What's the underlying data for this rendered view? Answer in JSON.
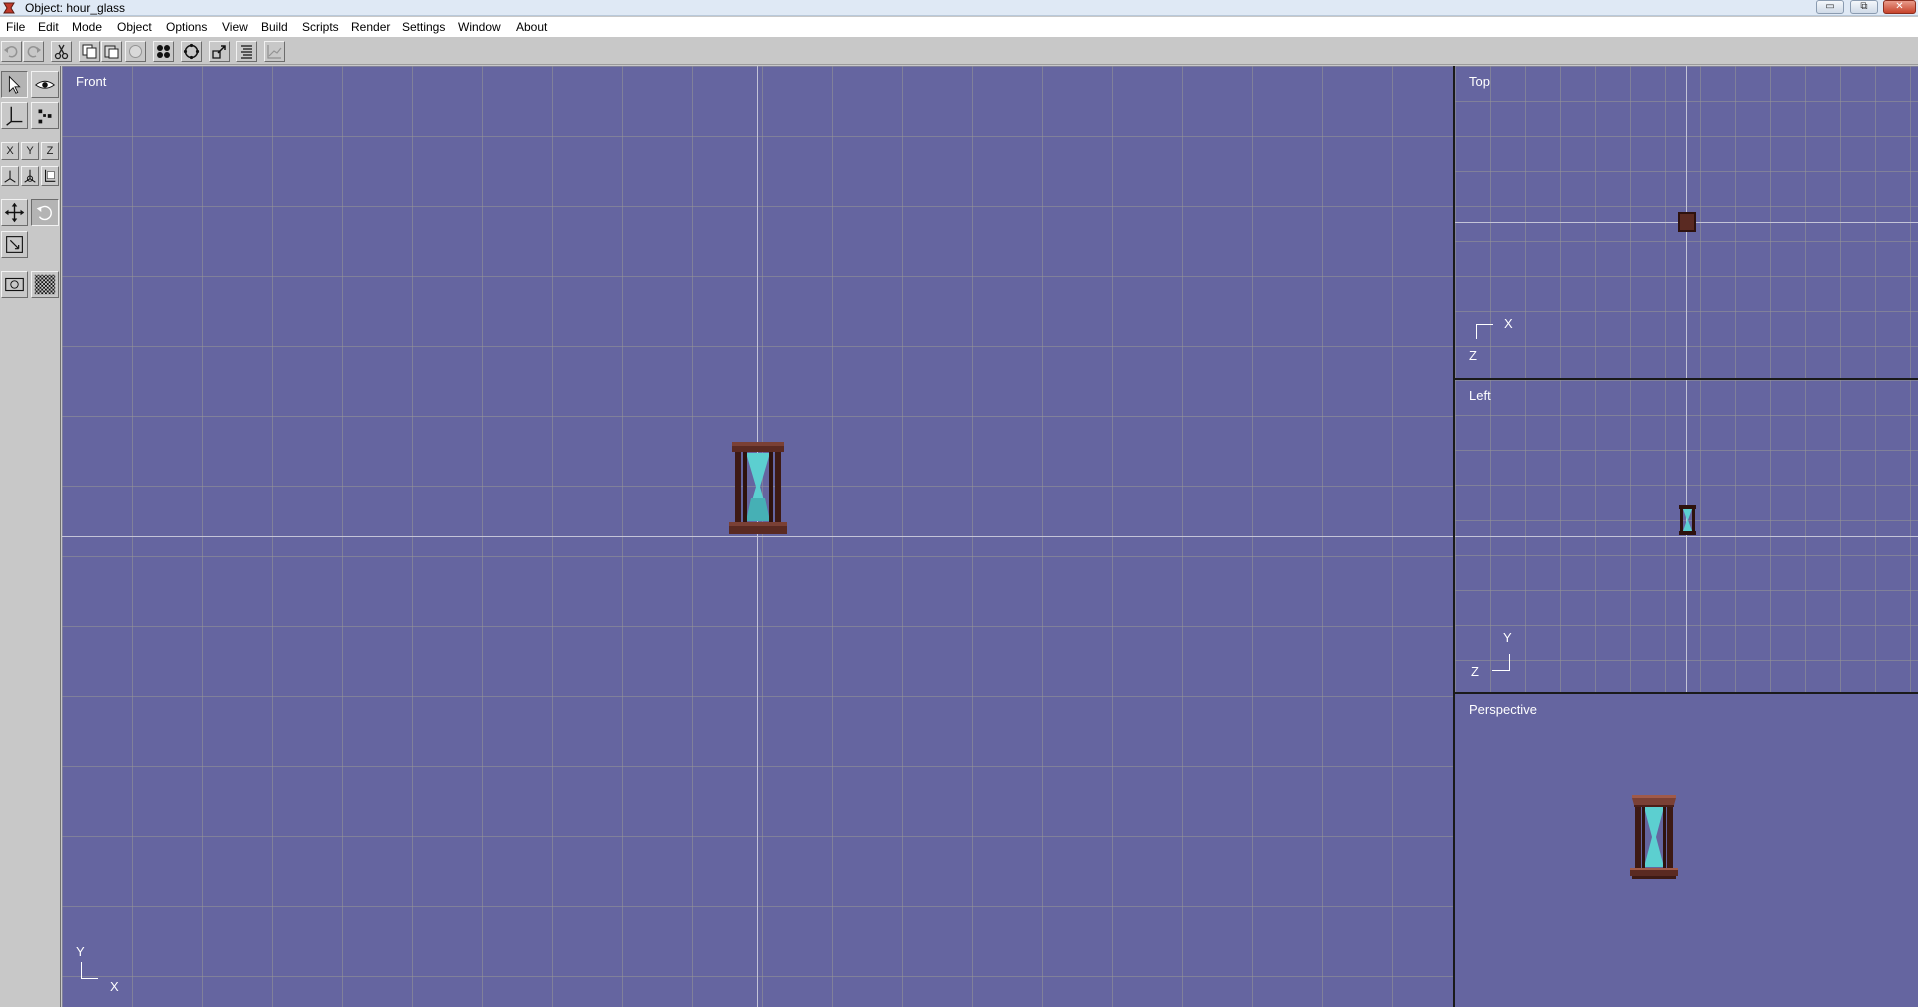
{
  "window": {
    "title": "Object: hour_glass",
    "controls": {
      "minimize": "▭",
      "restore": "⧉",
      "close": "✕"
    }
  },
  "menu": [
    "File",
    "Edit",
    "Mode",
    "Object",
    "Options",
    "View",
    "Build",
    "Scripts",
    "Render",
    "Settings",
    "Window",
    "About"
  ],
  "toolbar": {
    "icons": [
      "undo-icon",
      "redo-icon",
      "cut-icon",
      "copy-icon",
      "paste-icon",
      "clear-icon",
      "grid-snap-icon",
      "orbit-icon",
      "transform-icon",
      "list-icon",
      "graph-icon"
    ]
  },
  "tool_panel": {
    "axis_buttons": [
      "X",
      "Y",
      "Z"
    ]
  },
  "viewports": {
    "front": {
      "label": "Front",
      "axis_y": "Y",
      "axis_x": "X"
    },
    "top": {
      "label": "Top",
      "axis_x": "X",
      "axis_z": "Z"
    },
    "left": {
      "label": "Left",
      "axis_y": "Y",
      "axis_z": "Z"
    },
    "perspective": {
      "label": "Perspective"
    }
  },
  "colors": {
    "viewport_bg": "#6565a0",
    "wood": "#5a2a22",
    "wood_light": "#7a4035",
    "glass": "#5ccfd0"
  }
}
